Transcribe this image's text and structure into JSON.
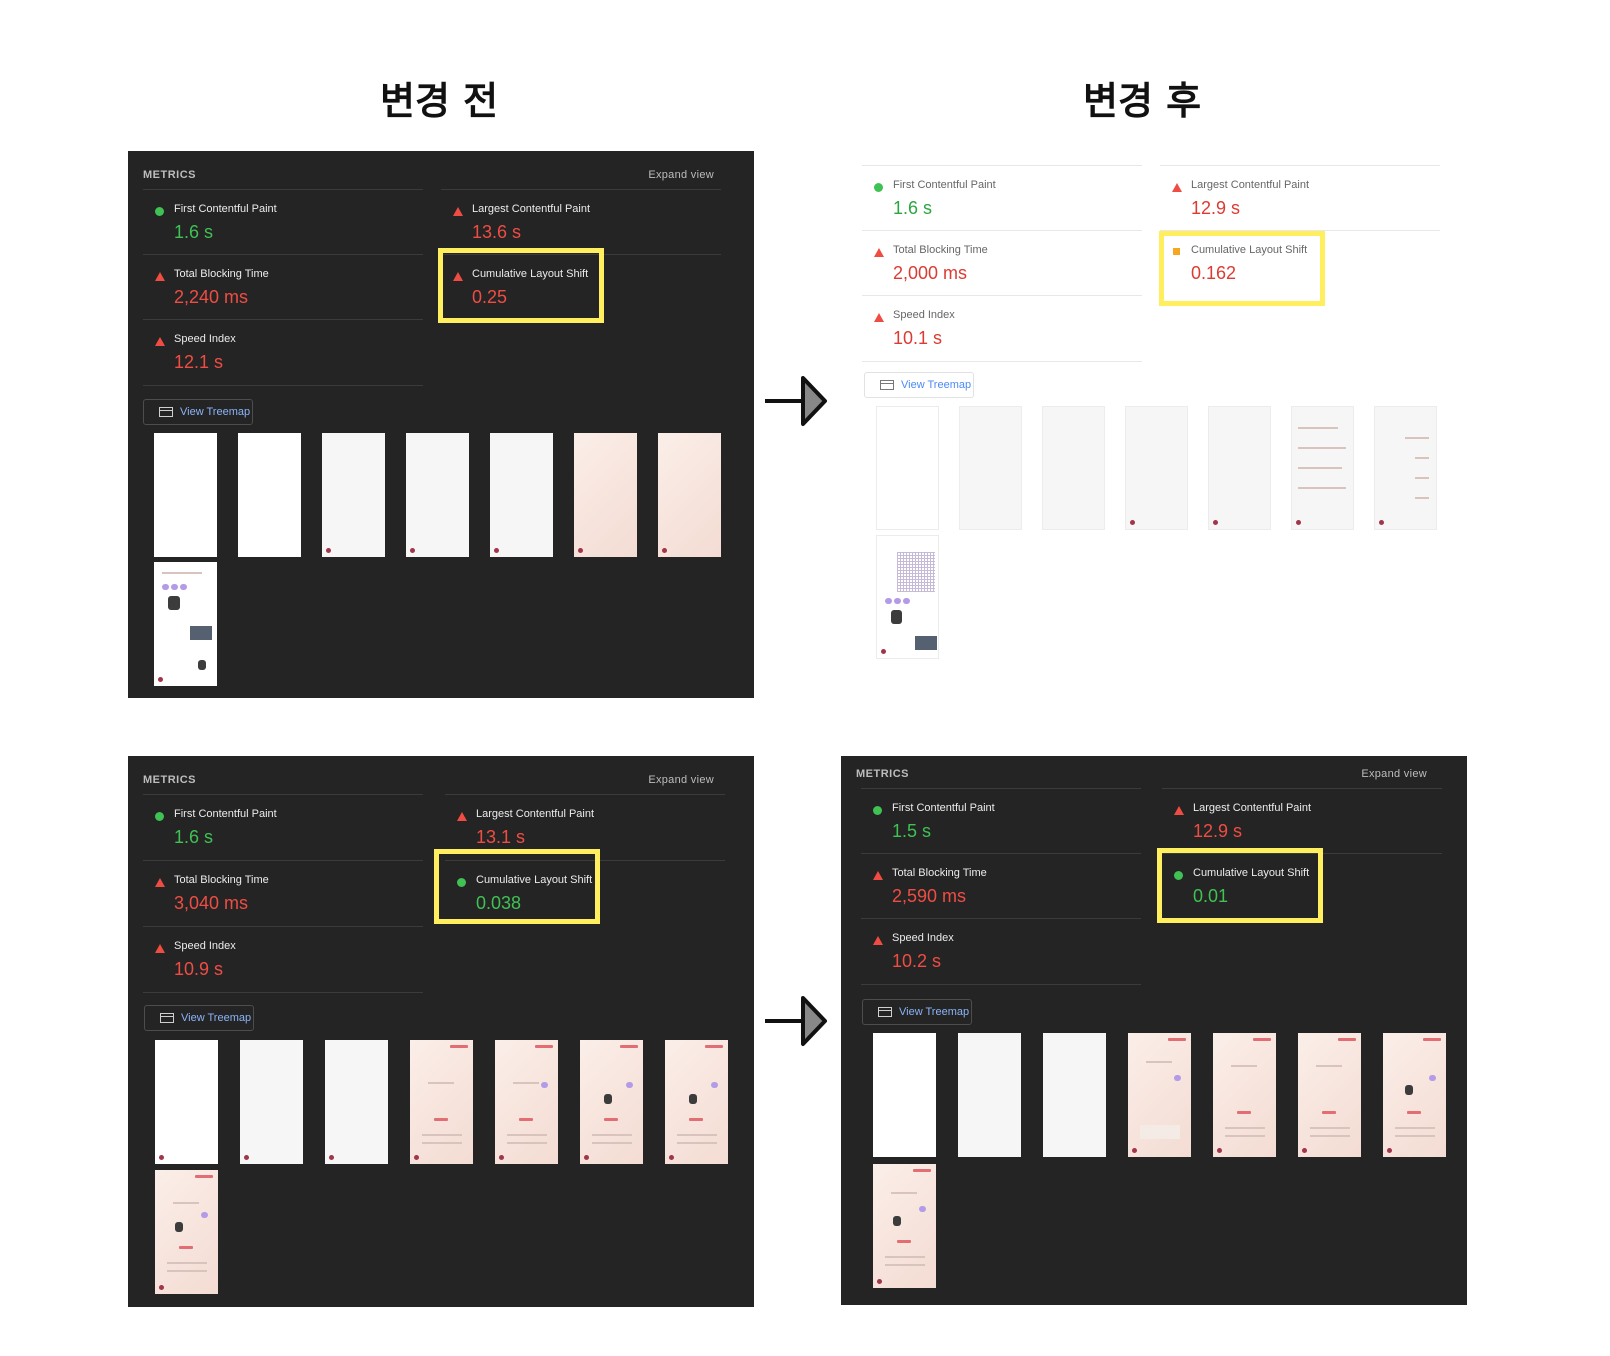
{
  "headings": {
    "before": "변경 전",
    "after": "변경 후"
  },
  "panels": {
    "top_before": {
      "title": "METRICS",
      "expand": "Expand view",
      "fcp": {
        "label": "First Contentful Paint",
        "value": "1.6 s",
        "status": "good"
      },
      "lcp": {
        "label": "Largest Contentful Paint",
        "value": "13.6 s",
        "status": "bad"
      },
      "tbt": {
        "label": "Total Blocking Time",
        "value": "2,240 ms",
        "status": "bad"
      },
      "cls": {
        "label": "Cumulative Layout Shift",
        "value": "0.25",
        "status": "bad"
      },
      "si": {
        "label": "Speed Index",
        "value": "12.1 s",
        "status": "bad"
      },
      "treemap": "View Treemap"
    },
    "top_after": {
      "title": "",
      "expand": "",
      "fcp": {
        "label": "First Contentful Paint",
        "value": "1.6 s",
        "status": "good"
      },
      "lcp": {
        "label": "Largest Contentful Paint",
        "value": "12.9 s",
        "status": "bad"
      },
      "tbt": {
        "label": "Total Blocking Time",
        "value": "2,000 ms",
        "status": "bad"
      },
      "cls": {
        "label": "Cumulative Layout Shift",
        "value": "0.162",
        "status": "average"
      },
      "si": {
        "label": "Speed Index",
        "value": "10.1 s",
        "status": "bad"
      },
      "treemap": "View Treemap"
    },
    "bottom_before": {
      "title": "METRICS",
      "expand": "Expand view",
      "fcp": {
        "label": "First Contentful Paint",
        "value": "1.6 s",
        "status": "good"
      },
      "lcp": {
        "label": "Largest Contentful Paint",
        "value": "13.1 s",
        "status": "bad"
      },
      "tbt": {
        "label": "Total Blocking Time",
        "value": "3,040 ms",
        "status": "bad"
      },
      "cls": {
        "label": "Cumulative Layout Shift",
        "value": "0.038",
        "status": "good"
      },
      "si": {
        "label": "Speed Index",
        "value": "10.9 s",
        "status": "bad"
      },
      "treemap": "View Treemap"
    },
    "bottom_after": {
      "title": "METRICS",
      "expand": "Expand view",
      "fcp": {
        "label": "First Contentful Paint",
        "value": "1.5 s",
        "status": "good"
      },
      "lcp": {
        "label": "Largest Contentful Paint",
        "value": "12.9 s",
        "status": "bad"
      },
      "tbt": {
        "label": "Total Blocking Time",
        "value": "2,590 ms",
        "status": "bad"
      },
      "cls": {
        "label": "Cumulative Layout Shift",
        "value": "0.01",
        "status": "good"
      },
      "si": {
        "label": "Speed Index",
        "value": "10.2 s",
        "status": "bad"
      },
      "treemap": "View Treemap"
    }
  },
  "colors": {
    "good": "#3fc153",
    "bad": "#ef4d44",
    "average": "#f5a623",
    "highlight": "#ffef5e",
    "panel_bg": "#242424"
  },
  "icons": {
    "arrow": "arrow-right-icon",
    "treemap": "treemap-icon"
  }
}
